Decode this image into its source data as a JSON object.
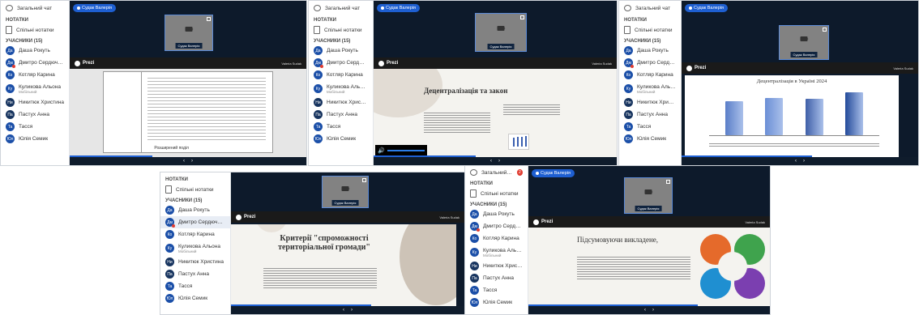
{
  "sidebar": {
    "general_chat": "Загальний чат",
    "notes_header": "НОТАТКИ",
    "shared_notes": "Спільні нотатки",
    "participants_header": "УЧАСНИКИ (15)",
    "participants": [
      {
        "initials": "Да",
        "name": "Даша Рокуть",
        "sub": ""
      },
      {
        "initials": "Дм",
        "name": "Дмитро Сердюченко",
        "sub": ""
      },
      {
        "initials": "Ко",
        "name": "Котляр Карина",
        "sub": ""
      },
      {
        "initials": "Ку",
        "name": "Куликова Альона",
        "sub": "Мобільний"
      },
      {
        "initials": "Ни",
        "name": "Никитюк Христина",
        "sub": ""
      },
      {
        "initials": "Па",
        "name": "Пастух Анна",
        "sub": ""
      },
      {
        "initials": "Та",
        "name": "Тасся",
        "sub": ""
      },
      {
        "initials": "Юл",
        "name": "Юлія Семик",
        "sub": ""
      }
    ],
    "badge_count": "2"
  },
  "host_label": "Судак Валерія",
  "camera_name": "Судак Валерія",
  "prezi_label": "Prezi",
  "presenter_short": "Valeria Sudak",
  "slides": {
    "s1_footer": "Розширений поділ",
    "s2_title": "Децентралізація та закон",
    "s3_title": "Децентралізація в Україні 2024",
    "s4_title": "Критерії \"спроможності територіальної громади\"",
    "s5_title": "Підсумовуючи викладене,"
  },
  "chart_data": {
    "type": "bar",
    "title": "Децентралізація в Україні 2024",
    "categories": [
      "",
      "",
      "",
      ""
    ],
    "values": [
      72,
      80,
      78,
      92
    ],
    "colors": [
      "#5a7ec8",
      "#6b8fd6",
      "#3f5fa8",
      "#234a9a"
    ]
  },
  "controls": {
    "prev": "‹",
    "next": "›",
    "volume": "🔊"
  }
}
